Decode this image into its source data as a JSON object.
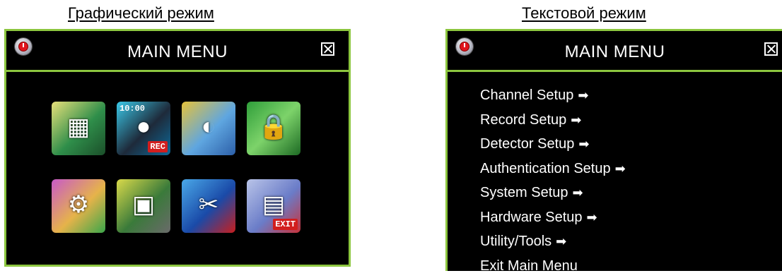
{
  "captions": {
    "graphic": "Графический режим",
    "text": "Текстовой режим"
  },
  "graphic_panel": {
    "title": "MAIN MENU",
    "icons": [
      {
        "name": "channel-setup-icon",
        "glyph": "▦",
        "gradient": "linear-gradient(135deg,#e8e07a,#2f8e4a 55%,#1b4f2a)"
      },
      {
        "name": "record-setup-icon",
        "glyph": "●",
        "clock": "10:00",
        "tag": "REC",
        "gradient": "linear-gradient(135deg,#3ac8e8,#1e2a3a 55%,#0d6a9a)"
      },
      {
        "name": "detector-setup-icon",
        "glyph": "◐",
        "gradient": "linear-gradient(135deg,#e6c23a,#5fa6e0 55%,#2c5fa8)"
      },
      {
        "name": "authentication-setup-icon",
        "glyph": "🔒",
        "gradient": "linear-gradient(135deg,#2f9e3a,#7dd36a 50%,#1d6a24)"
      },
      {
        "name": "system-setup-icon",
        "glyph": "⚙",
        "gradient": "linear-gradient(135deg,#c85ac8,#e6b34a 55%,#3aa64a)"
      },
      {
        "name": "hardware-setup-icon",
        "glyph": "▣",
        "gradient": "linear-gradient(135deg,#d9d94a,#3a7a3a 55%,#6a6a6a)"
      },
      {
        "name": "utility-tools-icon",
        "glyph": "✂",
        "gradient": "linear-gradient(135deg,#4aa8e8,#1a4aa8 55%,#c81e1e)"
      },
      {
        "name": "exit-main-menu-icon",
        "glyph": "▤",
        "tag": "EXIT",
        "gradient": "linear-gradient(135deg,#b9c4e8,#6a7cc8 55%,#c8323a)"
      }
    ]
  },
  "text_panel": {
    "title": "MAIN MENU",
    "arrow": "➡",
    "items": [
      {
        "label": "Channel Setup",
        "arrow": true
      },
      {
        "label": "Record Setup",
        "arrow": true
      },
      {
        "label": "Detector Setup",
        "arrow": true
      },
      {
        "label": "Authentication Setup",
        "arrow": true
      },
      {
        "label": "System Setup",
        "arrow": true
      },
      {
        "label": "Hardware Setup",
        "arrow": true
      },
      {
        "label": "Utility/Tools",
        "arrow": true
      },
      {
        "label": "Exit Main Menu",
        "arrow": false
      }
    ]
  },
  "colors": {
    "panel_bg": "#000000",
    "panel_border": "#8cc63f",
    "text": "#ffffff"
  }
}
